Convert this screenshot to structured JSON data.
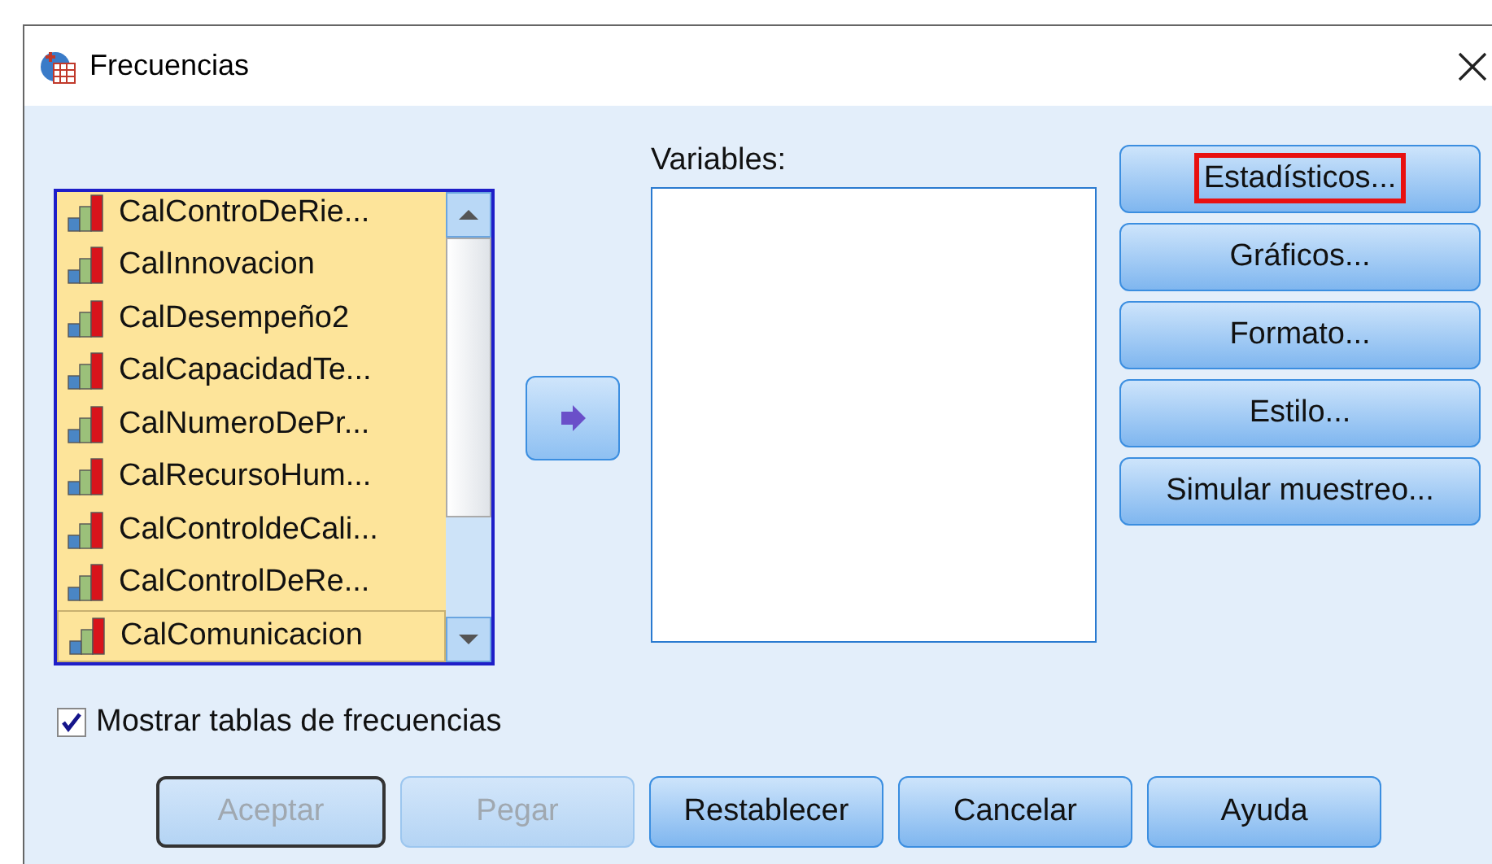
{
  "window": {
    "title": "Frecuencias"
  },
  "variable_list": {
    "items": [
      {
        "name": "CalControDeRie...",
        "selected": true,
        "focused": false
      },
      {
        "name": "CalInnovacion",
        "selected": true,
        "focused": false
      },
      {
        "name": "CalDesempeño2",
        "selected": true,
        "focused": false
      },
      {
        "name": "CalCapacidadTe...",
        "selected": true,
        "focused": false
      },
      {
        "name": "CalNumeroDePr...",
        "selected": true,
        "focused": false
      },
      {
        "name": "CalRecursoHum...",
        "selected": true,
        "focused": false
      },
      {
        "name": "CalControldeCali...",
        "selected": true,
        "focused": false
      },
      {
        "name": "CalControlDeRe...",
        "selected": true,
        "focused": false
      },
      {
        "name": "CalComunicacion",
        "selected": true,
        "focused": true
      }
    ]
  },
  "variables": {
    "label": "Variables:"
  },
  "side_buttons": [
    {
      "label": "Estadísticos...",
      "highlighted": true
    },
    {
      "label": "Gráficos...",
      "highlighted": false
    },
    {
      "label": "Formato...",
      "highlighted": false
    },
    {
      "label": "Estilo...",
      "highlighted": false
    },
    {
      "label": "Simular muestreo...",
      "highlighted": false
    }
  ],
  "show_tables": {
    "label": "Mostrar tablas de frecuencias",
    "checked": true
  },
  "buttons": [
    {
      "label": "Aceptar",
      "disabled": true,
      "default": true
    },
    {
      "label": "Pegar",
      "disabled": true,
      "default": false
    },
    {
      "label": "Restablecer",
      "disabled": false,
      "default": false
    },
    {
      "label": "Cancelar",
      "disabled": false,
      "default": false
    },
    {
      "label": "Ayuda",
      "disabled": false,
      "default": false
    }
  ]
}
